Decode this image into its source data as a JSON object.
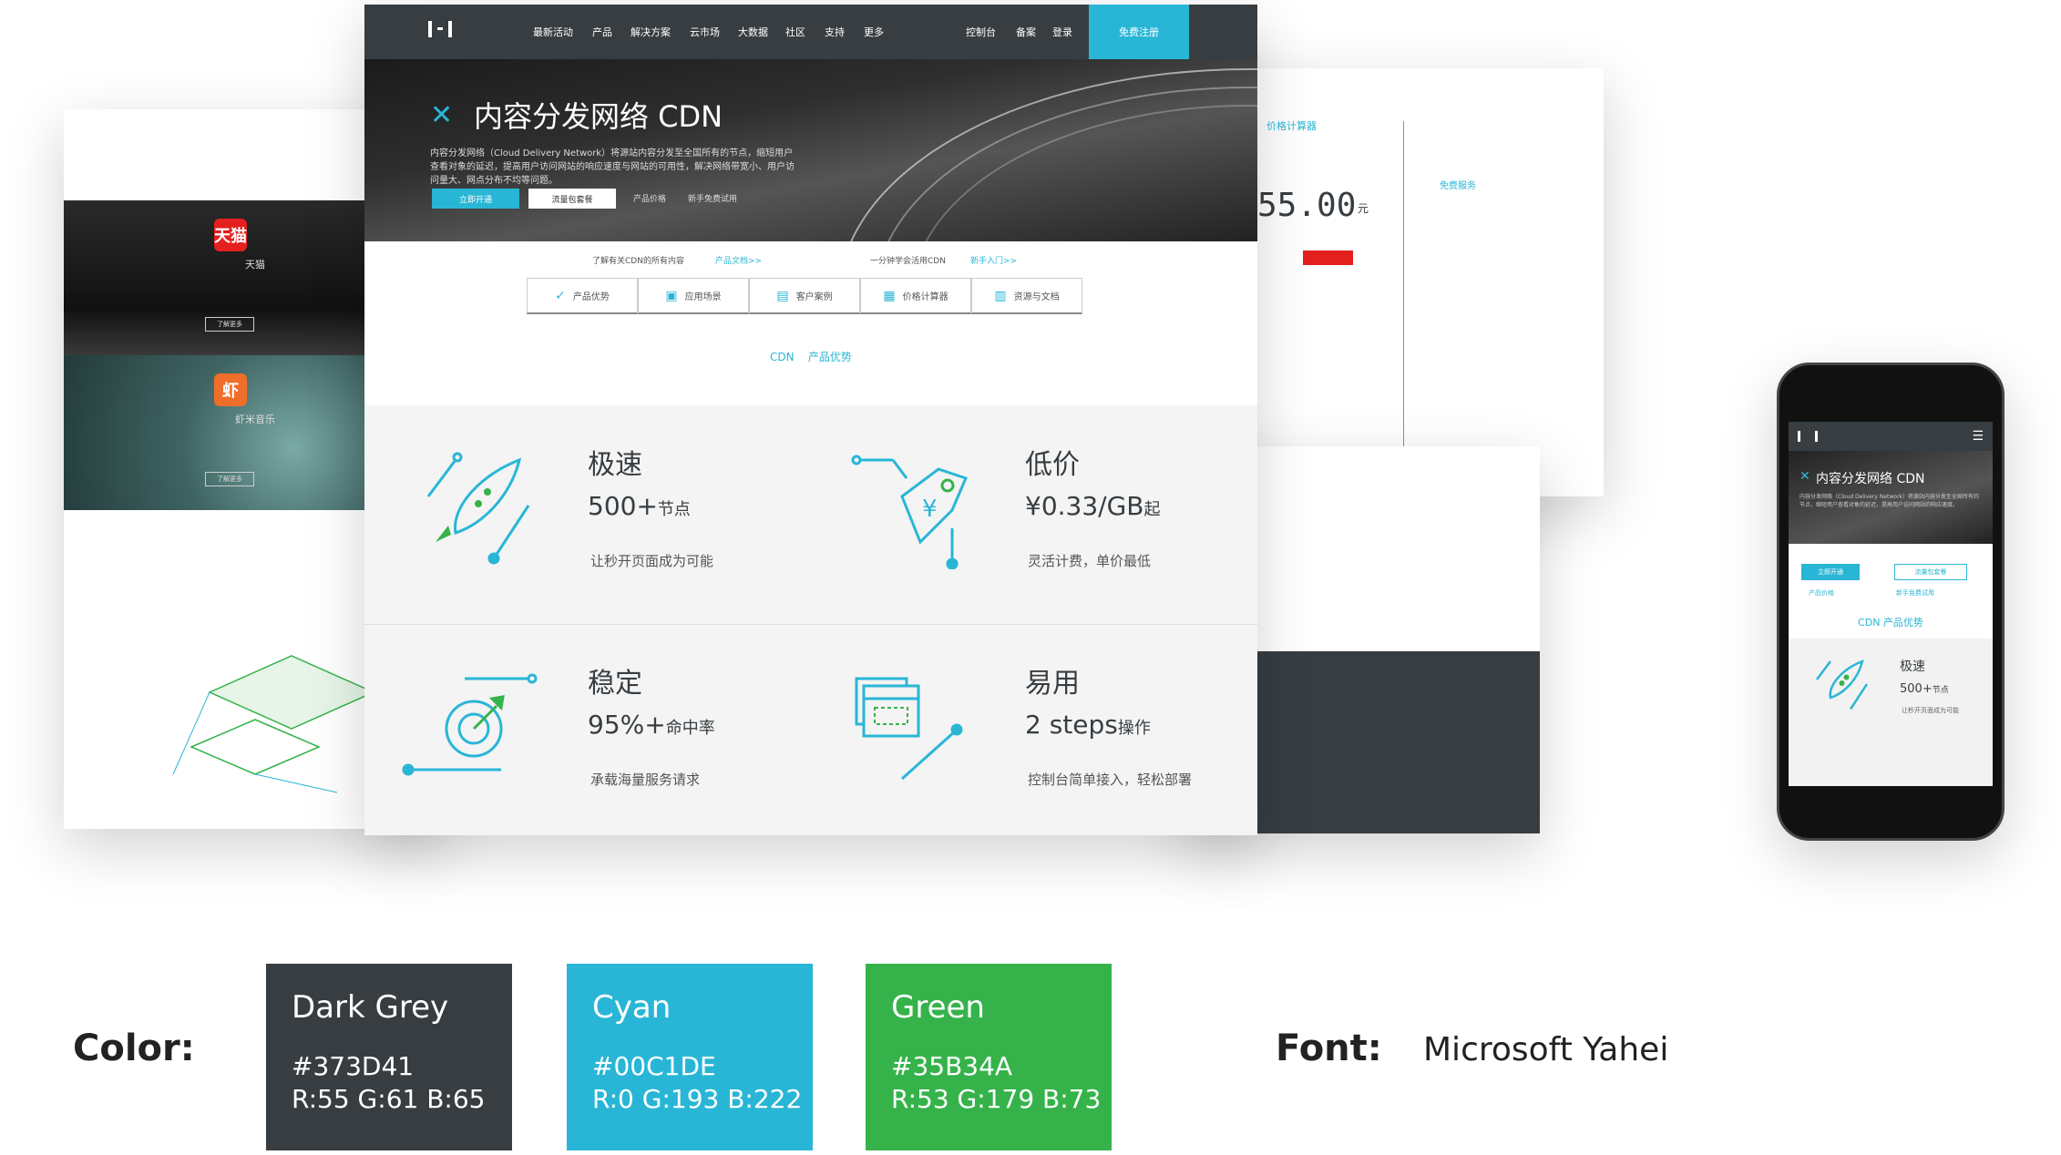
{
  "left_page": {
    "tiles": [
      {
        "logo": "天猫",
        "title": "天猫",
        "button": "了解更多",
        "color": "#e4201f"
      },
      {
        "logo": "虾",
        "title": "虾米音乐",
        "button": "了解更多",
        "color": "#f06e2a"
      }
    ]
  },
  "right_page": {
    "title": "价格计算器",
    "price": "55.00",
    "price_unit": "元",
    "free_section": "免费服务"
  },
  "nav": {
    "items": [
      "最新活动",
      "产品",
      "解决方案",
      "云市场",
      "大数据",
      "社区",
      "支持",
      "更多"
    ],
    "right_items": [
      "控制台",
      "备案",
      "登录"
    ],
    "cta": "免费注册"
  },
  "hero": {
    "title": "内容分发网络 CDN",
    "description": "内容分发网络（Cloud Delivery Network）将源站内容分发至全国所有的节点，缩短用户查看对象的延迟，提高用户访问网站的响应速度与网站的可用性，解决网络带宽小、用户访问量大、网点分布不均等问题。",
    "btn_open": "立即开通",
    "btn_consult": "流量包套餐",
    "link_price": "产品价格",
    "link_trial": "新手免费试用"
  },
  "info_row": {
    "text1": "了解有关CDN的所有内容",
    "link1": "产品文档>>",
    "text2": "一分钟学会活用CDN",
    "link2": "新手入门>>"
  },
  "tabs": [
    {
      "icon": "check-icon",
      "label": "产品优势"
    },
    {
      "icon": "scenario-icon",
      "label": "应用场景"
    },
    {
      "icon": "case-icon",
      "label": "客户案例"
    },
    {
      "icon": "calculator-icon",
      "label": "价格计算器"
    },
    {
      "icon": "doc-icon",
      "label": "资源与文档"
    }
  ],
  "crumb": {
    "a": "CDN",
    "b": "产品优势"
  },
  "features": [
    {
      "title": "极速",
      "value": "500+",
      "unit": "节点",
      "desc": "让秒开页面成为可能"
    },
    {
      "title": "低价",
      "value": "¥0.33/GB",
      "unit": "起",
      "desc": "灵活计费，单价最低"
    },
    {
      "title": "稳定",
      "value": "95%+",
      "unit": "命中率",
      "desc": "承载海量服务请求"
    },
    {
      "title": "易用",
      "value": "2 steps",
      "unit": "操作",
      "desc": "控制台简单接入，轻松部署"
    }
  ],
  "phone": {
    "hero_title": "内容分发网络 CDN",
    "hero_desc": "内容分发网络（Cloud Delivery Network）将源站内容分发至全国所有的节点，缩短用户查看对象的延迟，提高用户访问网站的响应速度。",
    "btn_open": "立即开通",
    "btn_consult": "流量包套餐",
    "link_price": "产品价格",
    "link_trial": "新手免费试用",
    "crumb": "CDN   产品优势",
    "feat_title": "极速",
    "feat_value": "500+",
    "feat_unit": "节点",
    "feat_desc": "让秒开页面成为可能"
  },
  "palette": {
    "label": "Color:",
    "swatches": [
      {
        "name": "Dark Grey",
        "hex": "#373D41",
        "rgb": "R:55 G:61 B:65",
        "color": "#373D41"
      },
      {
        "name": "Cyan",
        "hex": "#00C1DE",
        "rgb": "R:0 G:193 B:222",
        "color": "#29B6D6"
      },
      {
        "name": "Green",
        "hex": "#35B34A",
        "rgb": "R:53 G:179 B:73",
        "color": "#35B34A"
      }
    ]
  },
  "font": {
    "label": "Font:",
    "name": "Microsoft Yahei"
  }
}
